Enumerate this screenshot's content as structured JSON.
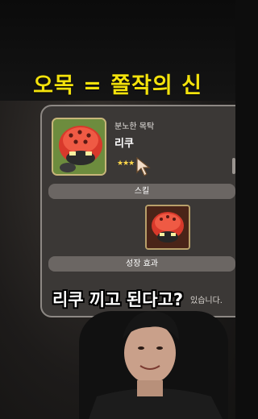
{
  "headline": "오목 = 쫄작의 신",
  "panel": {
    "subtitle": "분노한 목탁",
    "unit_name": "리쿠",
    "stars": "★★★",
    "skill_section_label": "스킬",
    "growth_section_label": "성장 효과",
    "partial_text": "있습니다."
  },
  "caption": "리쿠 끼고 된다고?",
  "colors": {
    "headline": "#f3e20c",
    "panel_bg": "#3b3836",
    "section_bar": "#6b6663",
    "portrait_frame": "#c8b67a"
  },
  "icons": {
    "portrait": "ladybug-helmet-character",
    "skill": "ladybug-skill-icon",
    "cursor": "pointer-arrow-cursor"
  }
}
